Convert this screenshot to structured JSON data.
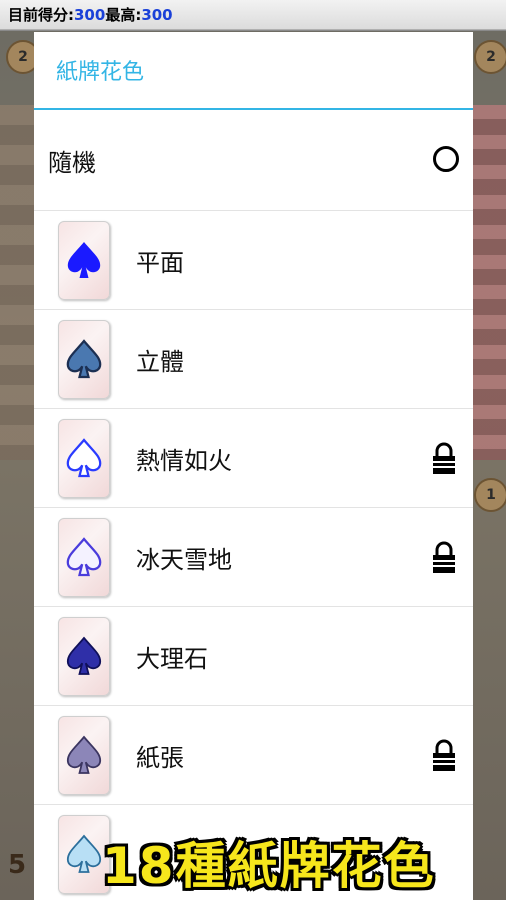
{
  "scorebar": {
    "current_label": "目前得分:",
    "current_value": "300",
    "best_label": " 最高:",
    "best_value": "300"
  },
  "background": {
    "avatar_left_badge": "2",
    "avatar_right_badge": "2",
    "avatar_mid_badge": "1",
    "bottom_left_number": "5"
  },
  "dialog": {
    "title": "紙牌花色",
    "random_label": "隨機",
    "items": [
      {
        "label": "平面",
        "locked": false,
        "icon": "spade-flat-icon"
      },
      {
        "label": "立體",
        "locked": false,
        "icon": "spade-3d-icon"
      },
      {
        "label": "熱情如火",
        "locked": true,
        "icon": "spade-fire-icon"
      },
      {
        "label": "冰天雪地",
        "locked": true,
        "icon": "spade-ice-icon"
      },
      {
        "label": "大理石",
        "locked": false,
        "icon": "spade-marble-icon"
      },
      {
        "label": "紙張",
        "locked": true,
        "icon": "spade-paper-icon"
      },
      {
        "label": "",
        "locked": false,
        "icon": "spade-glass-icon"
      }
    ]
  },
  "banner": {
    "text": "18種紙牌花色"
  },
  "colors": {
    "accent": "#33b5e5",
    "score_number": "#1a40d8",
    "banner_text": "#f6e61c"
  }
}
